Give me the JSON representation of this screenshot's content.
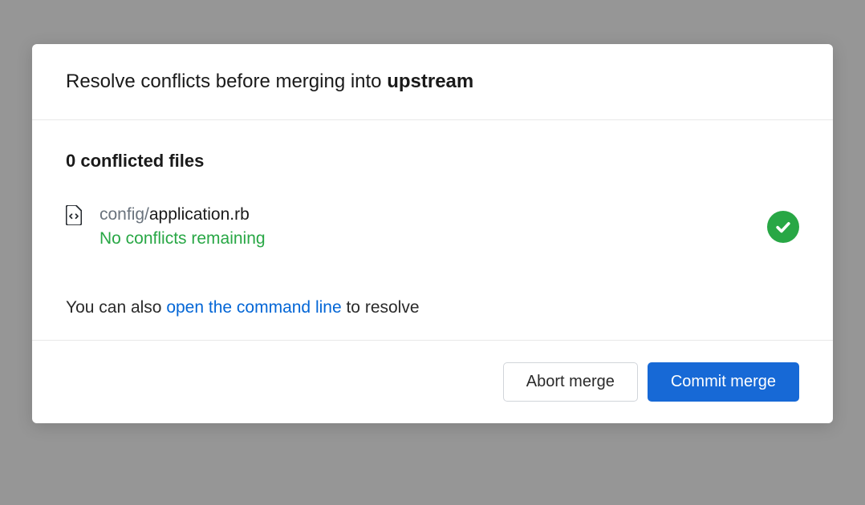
{
  "header": {
    "title_prefix": "Resolve conflicts before merging into ",
    "branch": "upstream"
  },
  "conflicts": {
    "count_label": "0 conflicted files"
  },
  "file": {
    "dir": "config/",
    "name": "application.rb",
    "status": "No conflicts remaining"
  },
  "hint": {
    "prefix": "You can also ",
    "link": "open the command line",
    "suffix": " to resolve"
  },
  "footer": {
    "abort_label": "Abort merge",
    "commit_label": "Commit merge"
  },
  "colors": {
    "success": "#28a745",
    "link": "#0366d6",
    "primary": "#1769d6"
  }
}
